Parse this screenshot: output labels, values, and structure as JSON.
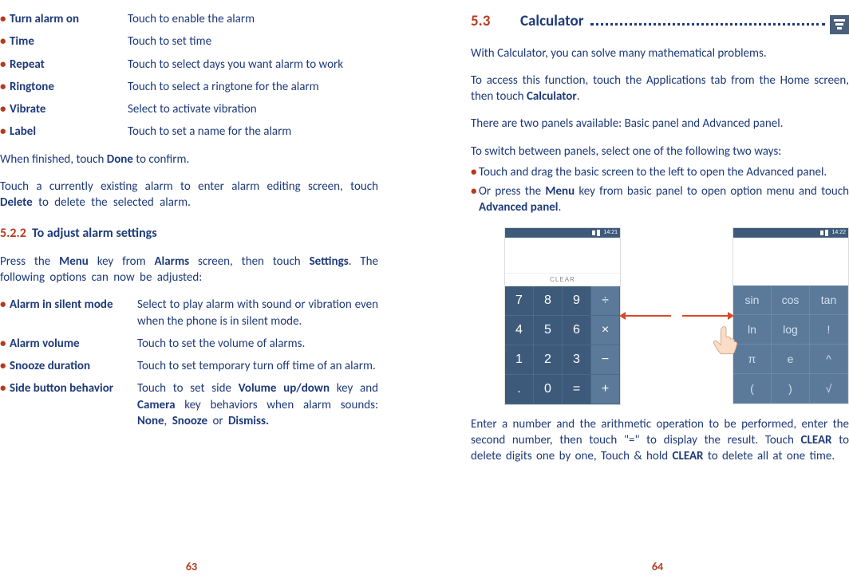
{
  "left": {
    "alarm_options": [
      {
        "term": "Turn alarm on",
        "desc": "Touch to enable the alarm"
      },
      {
        "term": "Time",
        "desc": "Touch to set time"
      },
      {
        "term": "Repeat",
        "desc": "Touch to select days you want alarm to work"
      },
      {
        "term": "Ringtone",
        "desc": "Touch to select a ringtone for the alarm"
      },
      {
        "term": "Vibrate",
        "desc": "Select to activate vibration"
      },
      {
        "term": "Label",
        "desc": "Touch to set a name for the alarm"
      }
    ],
    "finished_pre": "When finished, touch ",
    "finished_bold": "Done",
    "finished_post": " to confirm.",
    "edit_pre": "Touch a currently existing alarm to enter alarm editing screen, touch ",
    "edit_bold": "Delete",
    "edit_post": " to delete the selected alarm.",
    "h3_num": "5.2.2",
    "h3_title": "To adjust alarm settings",
    "settings_intro_1": "Press the ",
    "settings_intro_b1": "Menu",
    "settings_intro_2": " key from ",
    "settings_intro_b2": "Alarms",
    "settings_intro_3": " screen, then touch ",
    "settings_intro_b3": "Settings",
    "settings_intro_4": ". The following options can now be adjusted:",
    "settings": [
      {
        "term": "Alarm in silent mode",
        "desc": "Select to play alarm with sound or vibration even when the phone is in silent mode."
      },
      {
        "term": "Alarm volume",
        "desc": "Touch to set the volume of alarms."
      },
      {
        "term": "Snooze duration",
        "desc": "Touch to set temporary turn off time of an alarm."
      }
    ],
    "side_term": "Side button behavior",
    "side_1": "Touch to set side ",
    "side_b1": "Volume up/down",
    "side_2": " key and ",
    "side_b2": "Camera",
    "side_3": " key behaviors when alarm sounds: ",
    "side_b3": "None",
    "side_4": ", ",
    "side_b4": "Snooze",
    "side_5": " or ",
    "side_b5": "Dismiss.",
    "page_num": "63"
  },
  "right": {
    "h2_num": "5.3",
    "h2_title": "Calculator",
    "p1": "With Calculator, you can solve many mathematical problems.",
    "p2_a": "To access this function, touch the Applications tab from the Home screen, then touch ",
    "p2_b": "Calculator",
    "p2_c": ".",
    "p3": "There are two panels available: Basic panel and Advanced panel.",
    "p4": "To switch between panels, select one of the following two ways:",
    "li1": "Touch and drag the basic screen to the left to open the Advanced panel.",
    "li2_a": "Or press the ",
    "li2_b": "Menu",
    "li2_c": " key from basic panel to open option menu and touch ",
    "li2_d": "Advanced panel",
    "li2_e": ".",
    "basic": {
      "time": "14:21",
      "clear": "CLEAR",
      "keys": [
        {
          "l": "7"
        },
        {
          "l": "8"
        },
        {
          "l": "9"
        },
        {
          "l": "÷",
          "op": true
        },
        {
          "l": "4"
        },
        {
          "l": "5"
        },
        {
          "l": "6"
        },
        {
          "l": "×",
          "op": true
        },
        {
          "l": "1"
        },
        {
          "l": "2"
        },
        {
          "l": "3"
        },
        {
          "l": "−",
          "op": true
        },
        {
          "l": "."
        },
        {
          "l": "0"
        },
        {
          "l": "="
        },
        {
          "l": "+",
          "op": true
        }
      ]
    },
    "adv": {
      "time": "14:22",
      "keys": [
        "sin",
        "cos",
        "tan",
        "ln",
        "log",
        "!",
        "π",
        "e",
        "^",
        "(",
        ")",
        "√"
      ]
    },
    "p5_a": "Enter a number and the arithmetic operation to be performed, enter the second number, then touch \"=\" to display the result. Touch ",
    "p5_b": "CLEAR",
    "p5_c": " to delete digits one by one, Touch & hold ",
    "p5_d": "CLEAR",
    "p5_e": " to delete all at one time.",
    "page_num": "64"
  }
}
